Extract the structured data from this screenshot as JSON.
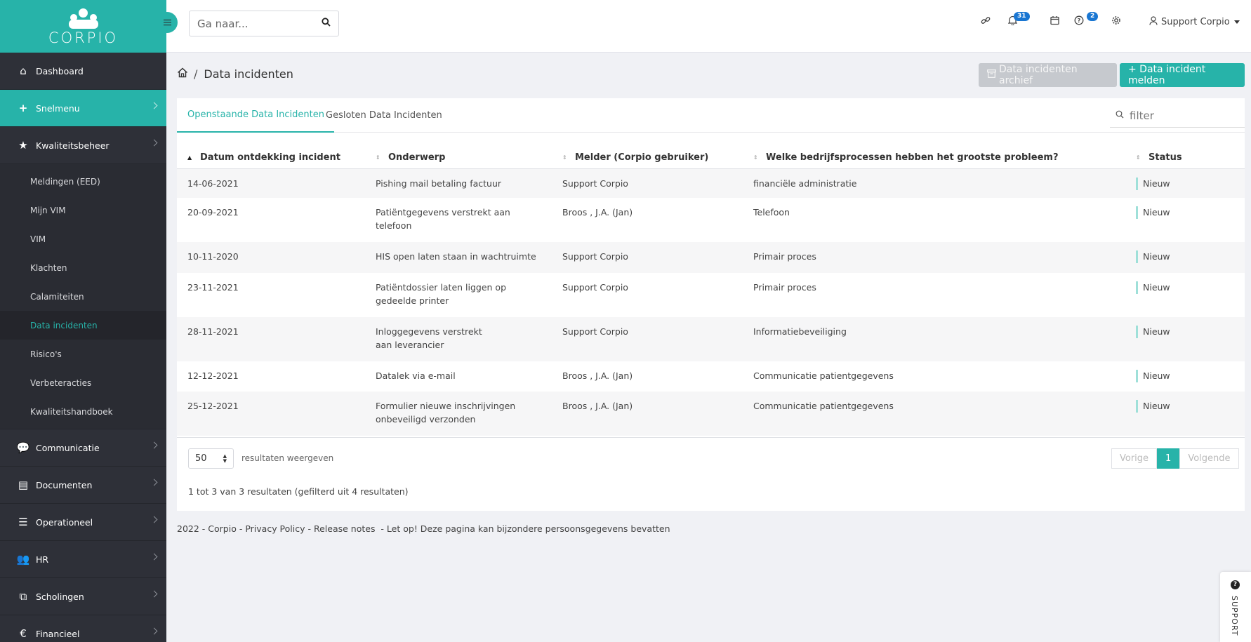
{
  "brand": {
    "name": "CORPIO",
    "accent": "#27b3a9"
  },
  "search": {
    "placeholder": "Ga naar..."
  },
  "topbar": {
    "notifications_count": "31",
    "help_count": "2",
    "user_name": "Support Corpio"
  },
  "sidebar": {
    "items": [
      {
        "label": "Dashboard",
        "icon": "home-icon"
      },
      {
        "label": "Snelmenu",
        "icon": "plus-icon"
      },
      {
        "label": "Kwaliteitsbeheer",
        "icon": "star-icon"
      },
      {
        "label": "Communicatie",
        "icon": "chat-icon"
      },
      {
        "label": "Documenten",
        "icon": "document-icon"
      },
      {
        "label": "Operationeel",
        "icon": "list-check-icon"
      },
      {
        "label": "HR",
        "icon": "users-icon"
      },
      {
        "label": "Scholingen",
        "icon": "presentation-icon"
      },
      {
        "label": "Financieel",
        "icon": "euro-icon"
      }
    ],
    "subitems": [
      {
        "label": "Meldingen (EED)"
      },
      {
        "label": "Mijn VIM"
      },
      {
        "label": "VIM"
      },
      {
        "label": "Klachten"
      },
      {
        "label": "Calamiteiten"
      },
      {
        "label": "Data incidenten"
      },
      {
        "label": "Risico's"
      },
      {
        "label": "Verbeteracties"
      },
      {
        "label": "Kwaliteitshandboek"
      }
    ]
  },
  "breadcrumb": {
    "separator": "/",
    "current": "Data incidenten"
  },
  "actions": {
    "archive_label": "Data incidenten archief",
    "new_label": "+ Data incident melden"
  },
  "tabs": [
    {
      "label": "Openstaande Data Incidenten"
    },
    {
      "label": "Gesloten Data Incidenten"
    }
  ],
  "filter": {
    "placeholder": "filter"
  },
  "table": {
    "columns": [
      "Datum ontdekking incident",
      "Onderwerp",
      "Melder (Corpio gebruiker)",
      "Welke bedrijfsprocessen hebben het grootste probleem?",
      "Status"
    ],
    "rows": [
      [
        "14-06-2021",
        "Pishing mail betaling factuur",
        "Support Corpio",
        "financiële administratie",
        "Nieuw"
      ],
      [
        "20-09-2021",
        "Patiëntgegevens verstrekt aan telefoon",
        "Broos , J.A. (Jan)",
        "Telefoon",
        "Nieuw"
      ],
      [
        "10-11-2020",
        "HIS open laten staan in wachtruimte",
        "Support Corpio",
        "Primair proces",
        "Nieuw"
      ],
      [
        "23-11-2021",
        "Patiëntdossier laten liggen op gedeelde printer",
        "Support Corpio",
        "Primair proces",
        "Nieuw"
      ],
      [
        "28-11-2021",
        "Inloggegevens verstrekt aan leverancier",
        "Support Corpio",
        "Informatiebeveiliging",
        "Nieuw"
      ],
      [
        "12-12-2021",
        "Datalek via e-mail",
        "Broos , J.A. (Jan)",
        "Communicatie patientgegevens",
        "Nieuw"
      ],
      [
        "25-12-2021",
        "Formulier nieuwe inschrijvingen onbeveiligd verzonden",
        "Broos , J.A. (Jan)",
        "Communicatie patientgegevens",
        "Nieuw"
      ]
    ]
  },
  "pagination": {
    "page_size": "50",
    "page_size_label": "resultaten weergeven",
    "prev": "Vorige",
    "current": "1",
    "next": "Volgende",
    "info": "1 tot 3 van 3 resultaten (gefilterd uit 4 resultaten)"
  },
  "footer": {
    "year": "2022",
    "brand": "Corpio",
    "privacy": "Privacy Policy",
    "release": "Release notes",
    "warning": "Let op! Deze pagina kan bijzondere persoonsgegevens bevatten"
  },
  "support": {
    "label": "SUPPORT"
  }
}
